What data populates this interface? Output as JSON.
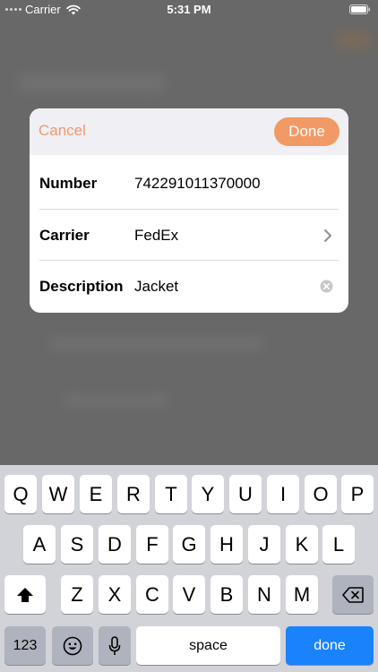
{
  "status_bar": {
    "carrier": "Carrier",
    "time": "5:31 PM"
  },
  "dialog": {
    "cancel_label": "Cancel",
    "done_label": "Done",
    "accent_color": "#f29a65",
    "fields": [
      {
        "label": "Number",
        "value": "742291011370000"
      },
      {
        "label": "Carrier",
        "value": "FedEx",
        "accessory": "chevron-right-icon"
      },
      {
        "label": "Description",
        "value": "Jacket",
        "accessory": "clear-icon"
      }
    ]
  },
  "keyboard": {
    "row1": [
      "Q",
      "W",
      "E",
      "R",
      "T",
      "Y",
      "U",
      "I",
      "O",
      "P"
    ],
    "row2": [
      "A",
      "S",
      "D",
      "F",
      "G",
      "H",
      "J",
      "K",
      "L"
    ],
    "row3": [
      "Z",
      "X",
      "C",
      "V",
      "B",
      "N",
      "M"
    ],
    "numbers_label": "123",
    "space_label": "space",
    "return_label": "done",
    "return_color": "#1a82fb"
  }
}
